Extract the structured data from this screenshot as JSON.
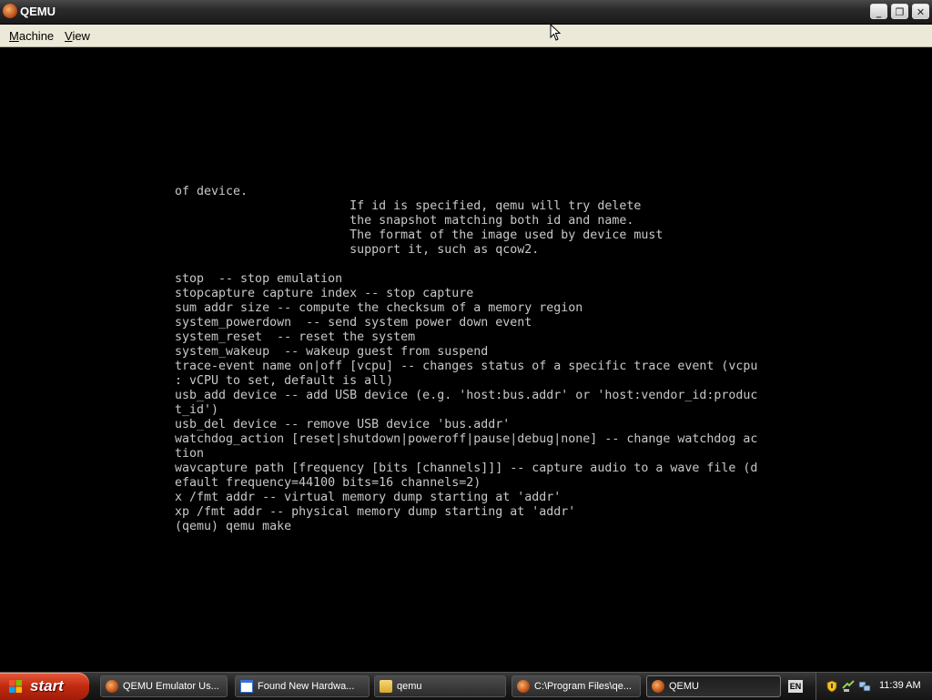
{
  "window": {
    "title": "QEMU",
    "controls": {
      "minimize": "_",
      "maximize": "❐",
      "close": "✕"
    }
  },
  "menu": [
    {
      "label": "Machine"
    },
    {
      "label": "View"
    }
  ],
  "console": {
    "text": "of device.\n                        If id is specified, qemu will try delete\n                        the snapshot matching both id and name.\n                        The format of the image used by device must\n                        support it, such as qcow2.\n\nstop  -- stop emulation\nstopcapture capture index -- stop capture\nsum addr size -- compute the checksum of a memory region\nsystem_powerdown  -- send system power down event\nsystem_reset  -- reset the system\nsystem_wakeup  -- wakeup guest from suspend\ntrace-event name on|off [vcpu] -- changes status of a specific trace event (vcpu\n: vCPU to set, default is all)\nusb_add device -- add USB device (e.g. 'host:bus.addr' or 'host:vendor_id:produc\nt_id')\nusb_del device -- remove USB device 'bus.addr'\nwatchdog_action [reset|shutdown|poweroff|pause|debug|none] -- change watchdog ac\ntion\nwavcapture path [frequency [bits [channels]]] -- capture audio to a wave file (d\nefault frequency=44100 bits=16 channels=2)\nx /fmt addr -- virtual memory dump starting at 'addr'\nxp /fmt addr -- physical memory dump starting at 'addr'\n(qemu) qemu make"
  },
  "taskbar": {
    "start_label": "start",
    "tasks": [
      {
        "label": "QEMU Emulator Us...",
        "icon": "qemu-icon"
      },
      {
        "label": "Found New Hardwa...",
        "icon": "window-icon"
      },
      {
        "label": "qemu",
        "icon": "folder-icon"
      },
      {
        "label": "C:\\Program Files\\qe...",
        "icon": "qemu-icon"
      },
      {
        "label": "QEMU",
        "icon": "qemu-icon"
      }
    ],
    "language_indicator": "EN",
    "clock": "11:39 AM"
  },
  "colors": {
    "console_bg": "#000000",
    "console_fg": "#c8c8c8",
    "start_button": "#c02a10",
    "menubar": "#ece9d8"
  }
}
